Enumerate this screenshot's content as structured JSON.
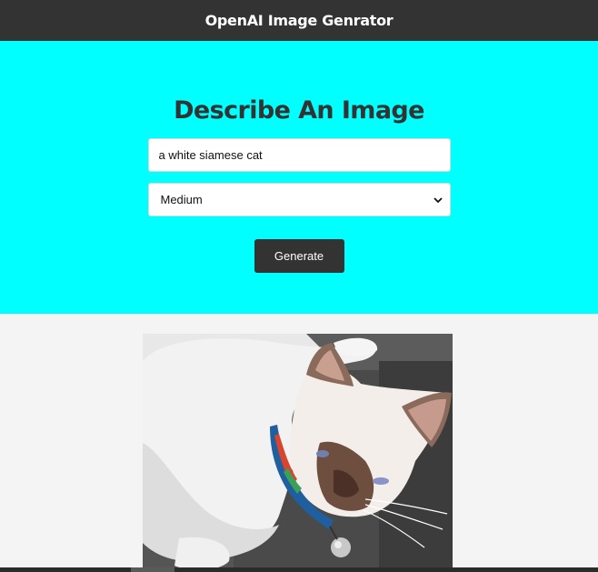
{
  "navbar": {
    "title": "OpenAI Image Genrator"
  },
  "showcase": {
    "heading": "Describe An Image",
    "prompt_value": "a white siamese cat",
    "size_selected": "Medium",
    "generate_label": "Generate"
  },
  "colors": {
    "navbar_bg": "#333333",
    "showcase_bg": "#00ffff",
    "page_bg": "#f4f4f4",
    "button_bg": "#333333"
  },
  "icons": {
    "select_arrow": "chevron-down-icon"
  }
}
